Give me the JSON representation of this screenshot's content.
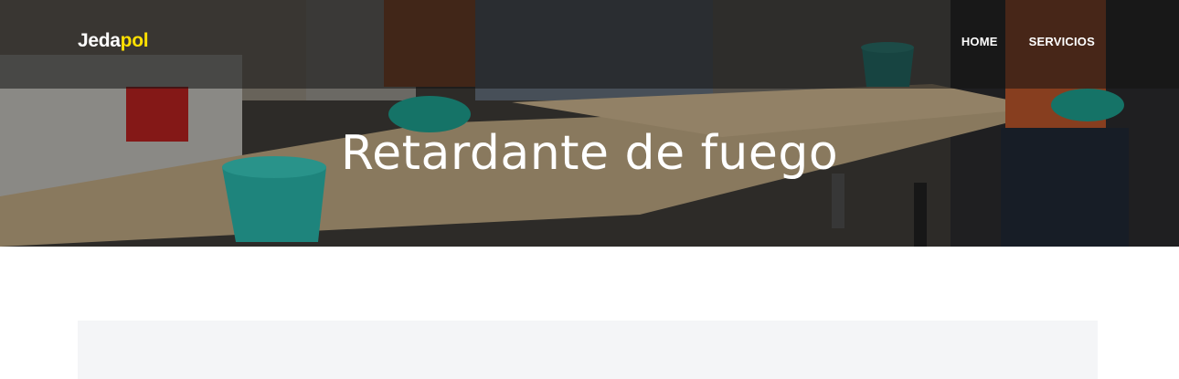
{
  "brand": {
    "part1": "Jeda",
    "part2": "pol",
    "accent_color": "#ffe100"
  },
  "nav": {
    "items": [
      {
        "label": "HOME"
      },
      {
        "label": "SERVICIOS"
      }
    ]
  },
  "hero": {
    "title": "Retardante de fuego",
    "image": "workers-treating-osb-boards-photo"
  }
}
